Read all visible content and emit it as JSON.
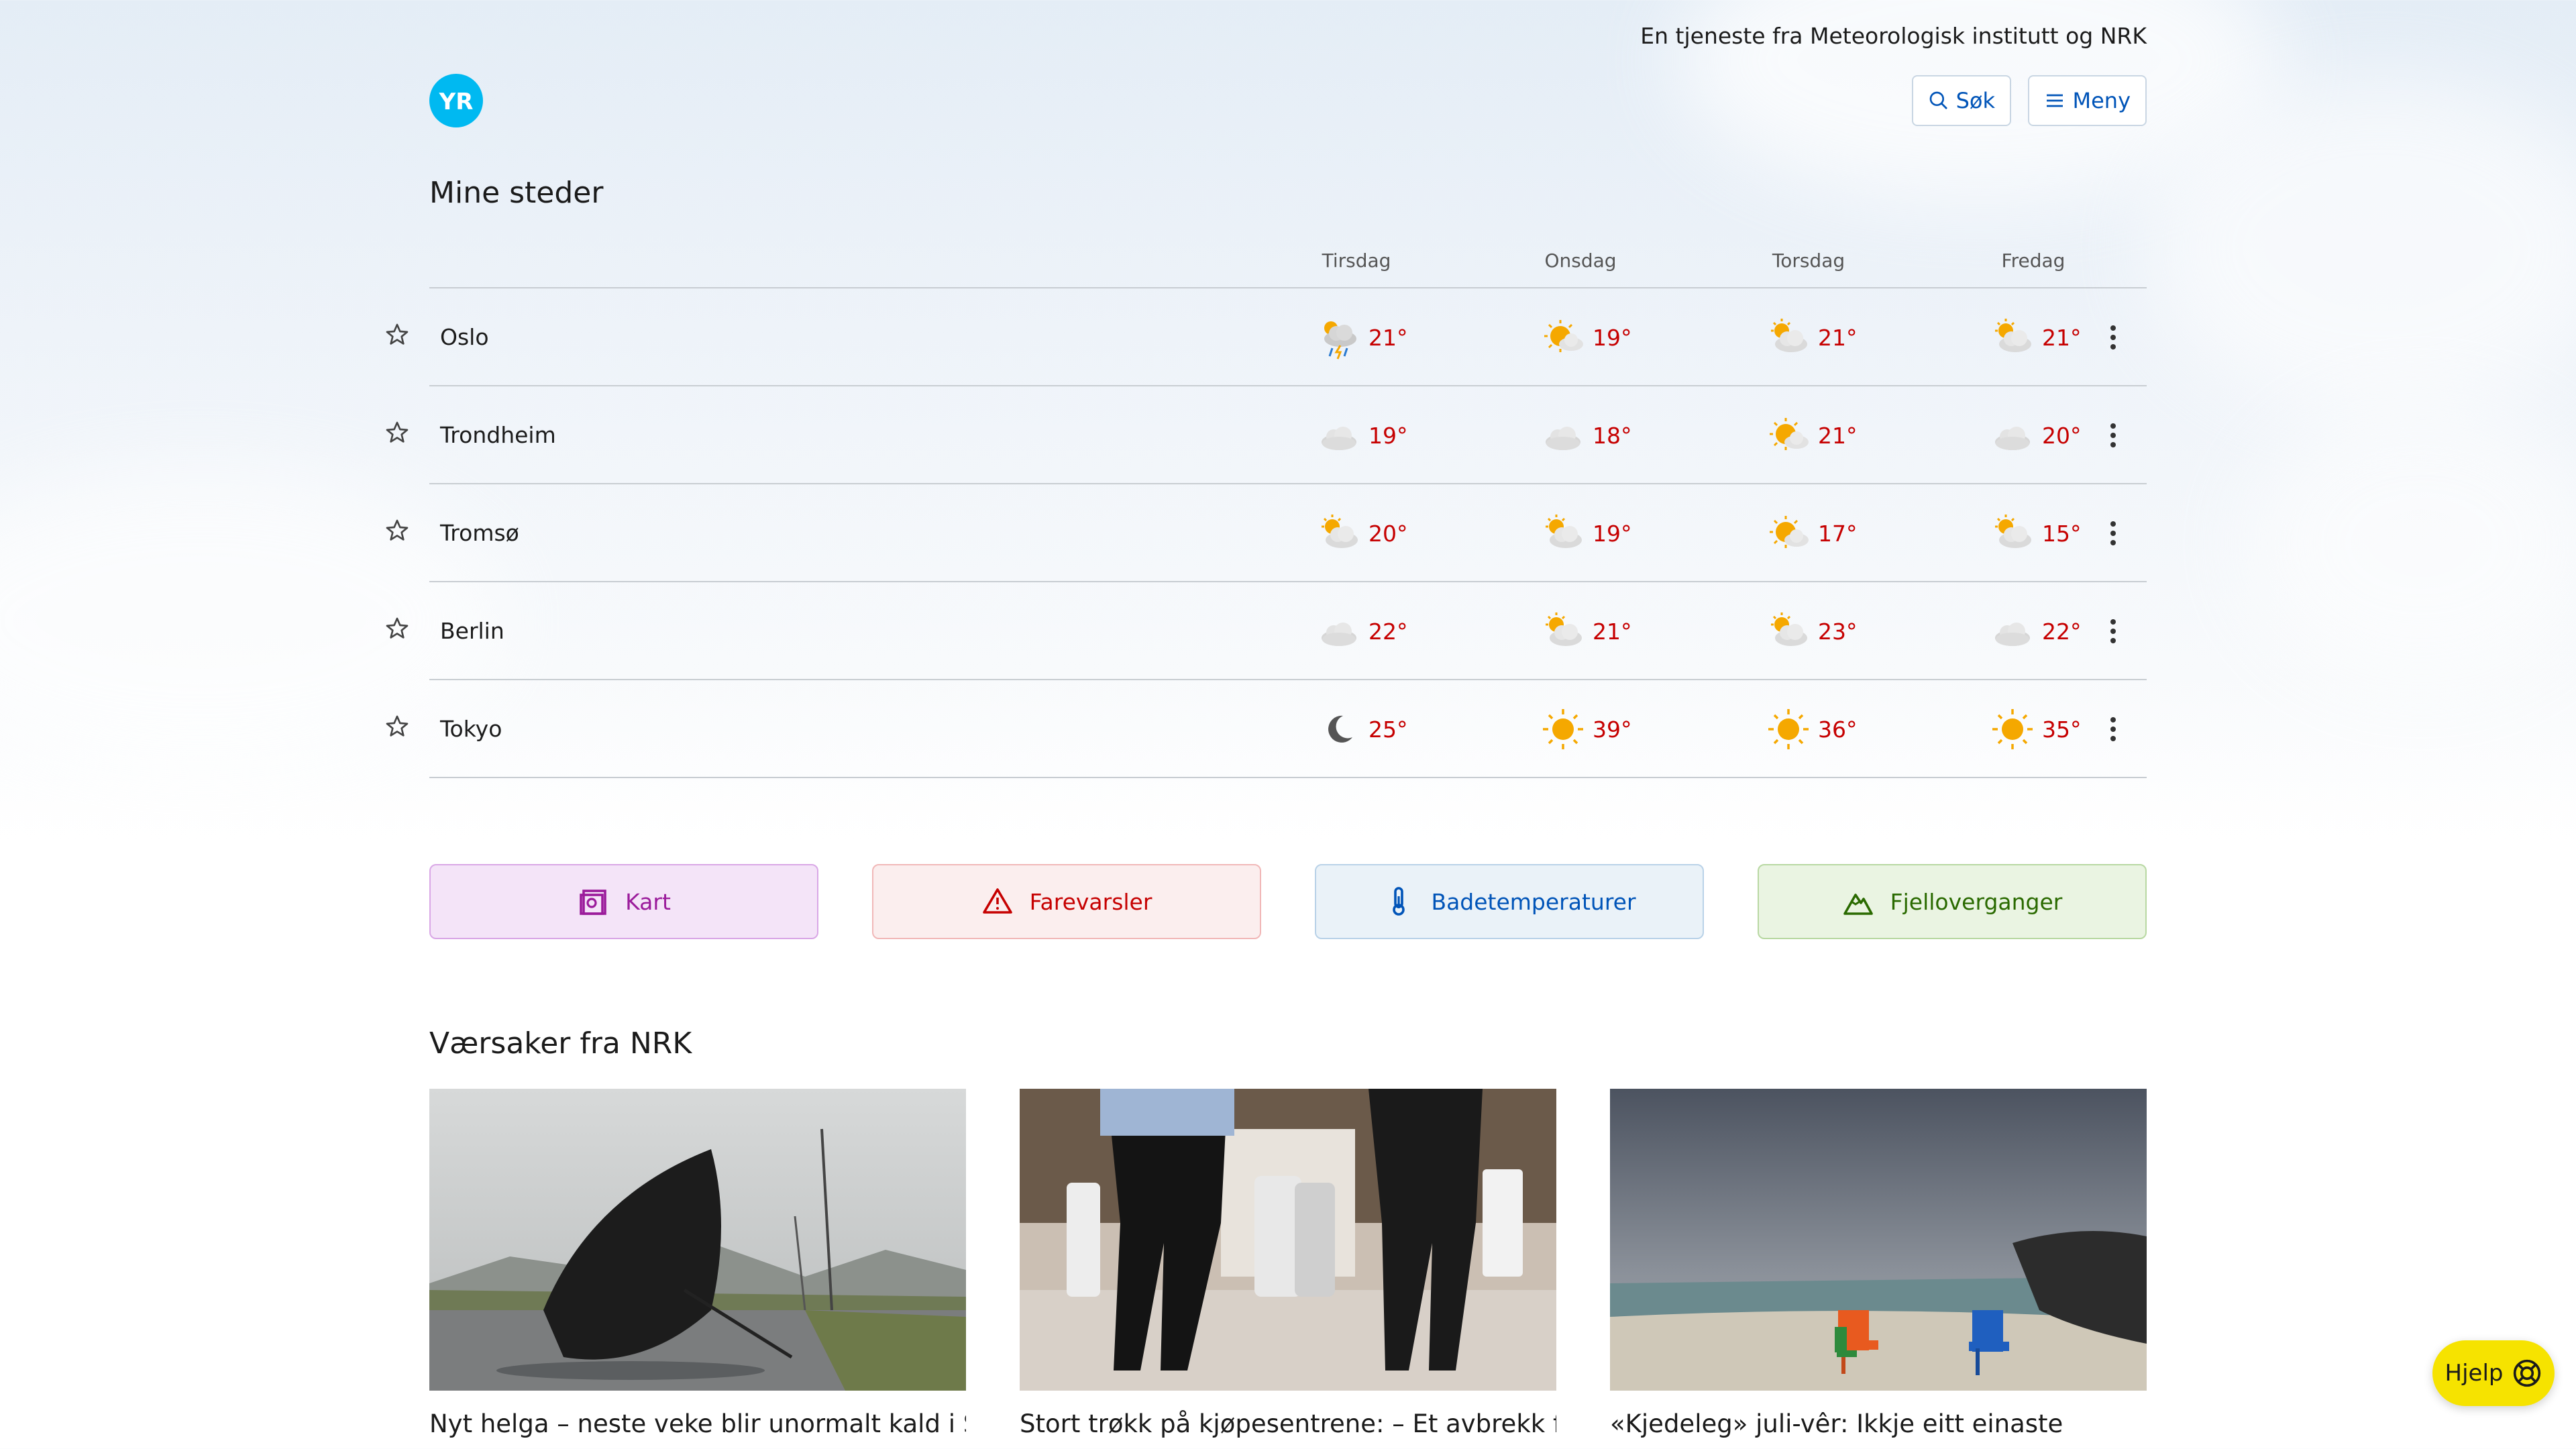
{
  "header": {
    "tagline": "En tjeneste fra Meteorologisk institutt og NRK",
    "logo_text": "YR",
    "search_label": "Søk",
    "menu_label": "Meny"
  },
  "my_places": {
    "title": "Mine steder",
    "days": [
      "Tirsdag",
      "Onsdag",
      "Torsdag",
      "Fredag"
    ],
    "rows": [
      {
        "city": "Oslo",
        "forecast": [
          {
            "icon": "cloud-sun-thunder-rain-icon",
            "temp": "21°"
          },
          {
            "icon": "sun-partly-cloudy-icon",
            "temp": "19°"
          },
          {
            "icon": "cloud-sun-icon",
            "temp": "21°"
          },
          {
            "icon": "cloud-sun-icon",
            "temp": "21°"
          }
        ]
      },
      {
        "city": "Trondheim",
        "forecast": [
          {
            "icon": "cloud-icon",
            "temp": "19°"
          },
          {
            "icon": "cloud-icon",
            "temp": "18°"
          },
          {
            "icon": "sun-partly-cloudy-icon",
            "temp": "21°"
          },
          {
            "icon": "cloud-icon",
            "temp": "20°"
          }
        ]
      },
      {
        "city": "Tromsø",
        "forecast": [
          {
            "icon": "cloud-sun-icon",
            "temp": "20°"
          },
          {
            "icon": "cloud-sun-icon",
            "temp": "19°"
          },
          {
            "icon": "sun-partly-cloudy-icon",
            "temp": "17°"
          },
          {
            "icon": "cloud-sun-icon",
            "temp": "15°"
          }
        ]
      },
      {
        "city": "Berlin",
        "forecast": [
          {
            "icon": "cloud-icon",
            "temp": "22°"
          },
          {
            "icon": "cloud-sun-icon",
            "temp": "21°"
          },
          {
            "icon": "cloud-sun-icon",
            "temp": "23°"
          },
          {
            "icon": "cloud-icon",
            "temp": "22°"
          }
        ]
      },
      {
        "city": "Tokyo",
        "forecast": [
          {
            "icon": "moon-icon",
            "temp": "25°"
          },
          {
            "icon": "sun-icon",
            "temp": "39°"
          },
          {
            "icon": "sun-icon",
            "temp": "36°"
          },
          {
            "icon": "sun-icon",
            "temp": "35°"
          }
        ]
      }
    ]
  },
  "quick_links": [
    {
      "label": "Kart",
      "icon": "map-icon",
      "color": "#9b1b9b",
      "bg": "#f4e4f8",
      "border": "#d9a7e6"
    },
    {
      "label": "Farevarsler",
      "icon": "warning-triangle-icon",
      "color": "#c60000",
      "bg": "#fbeeee",
      "border": "#f1b8b8"
    },
    {
      "label": "Badetemperaturer",
      "icon": "thermometer-icon",
      "color": "#0054b8",
      "bg": "#eaf2f8",
      "border": "#b9d2e8"
    },
    {
      "label": "Fjelloverganger",
      "icon": "mountain-icon",
      "color": "#2a6a00",
      "bg": "#eaf4e2",
      "border": "#b8d8a2"
    }
  ],
  "news": {
    "title": "Værsaker fra NRK",
    "items": [
      {
        "title": "Nyt helga – neste veke blir unormalt kald i Sør-",
        "image": "umbrella-on-wet-road"
      },
      {
        "title": "Stort trøkk på kjøpesentrene: – Et avbrekk fra",
        "image": "shoppers-in-mall"
      },
      {
        "title": "«Kjedeleg» juli-vêr: Ikkje eitt einaste",
        "image": "beach-chairs-cloudy-sky"
      }
    ]
  },
  "help": {
    "label": "Hjelp"
  }
}
